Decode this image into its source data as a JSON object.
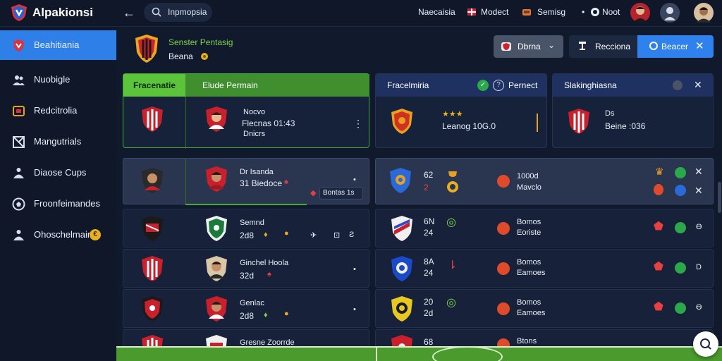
{
  "app": {
    "title": "Alpakionsi"
  },
  "search": {
    "text": "Inpmopsia"
  },
  "topnav": {
    "link1": "Naecaisia",
    "link2": "Modect",
    "link3": "Semisg",
    "link4": "Noot"
  },
  "sidebar": {
    "items": [
      {
        "label": "Beahitiania"
      },
      {
        "label": "Nuobigle"
      },
      {
        "label": "Redcitrolia"
      },
      {
        "label": "Mangutrials"
      },
      {
        "label": "Diaose Cups"
      },
      {
        "label": "Froonfeimandes"
      },
      {
        "label": "Ohoschelmaim"
      }
    ]
  },
  "club": {
    "name": "Senster Pentasig",
    "sub": "Beana"
  },
  "buttons": {
    "dropdown": "Dbrna",
    "dark": "Recciona",
    "blue": "Beacer"
  },
  "panel_green": {
    "tab1": "Fracenatie",
    "tab2": "Elude Permain",
    "line1": "Nocvo",
    "line2": "Flecnas 01:43",
    "line3": "Dnicrs"
  },
  "panel_blue": {
    "title": "Fracelmiria",
    "action": "Pernect",
    "line1": "Leanog 10G.0",
    "stars": "★★★"
  },
  "panel_blue2": {
    "title": "Slakinghiasna",
    "line1": "Ds",
    "line2": "Beine :036"
  },
  "left_rows": [
    {
      "line1": "Dr Isanda",
      "line2": "31 Biedoce",
      "tag": "Bontas 1s"
    },
    {
      "line1": "Semnd",
      "line2": "2d8"
    },
    {
      "line1": "Ginchel Hoola",
      "line2": "32d"
    },
    {
      "line1": "Genlac",
      "line2": "2d8"
    },
    {
      "line1": "Gresne Zoorrde"
    }
  ],
  "right_rows": [
    {
      "a": "62",
      "b": "2",
      "c1": "1000d",
      "c2": "Mavclo"
    },
    {
      "a": "6N",
      "b": "24",
      "c1": "Bomos",
      "c2": "Eoriste"
    },
    {
      "a": "8A",
      "b": "24",
      "c1": "Bomos",
      "c2": "Eamoes"
    },
    {
      "a": "20",
      "b": "2d",
      "c1": "Bomos",
      "c2": "Eamoes"
    },
    {
      "a": "68",
      "c1": "Btons"
    }
  ],
  "colors": {
    "accent": "#2f82ee",
    "green": "#5bc43a",
    "bg": "#111a2c",
    "red": "#e84040"
  },
  "icons": [
    "shield-logo-icon",
    "back-arrow-icon",
    "search-icon",
    "flag-icon",
    "cart-icon",
    "avatar-icon",
    "chat-fab-icon"
  ]
}
